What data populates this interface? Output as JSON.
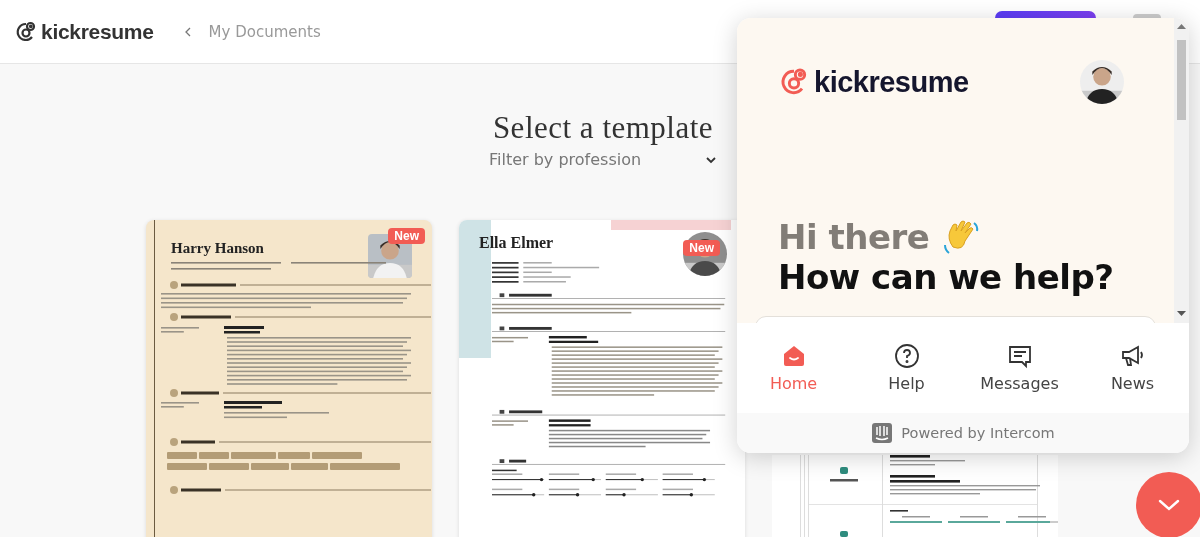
{
  "header": {
    "logo": "kickresume",
    "breadcrumb": "My Documents"
  },
  "page": {
    "title": "Select a template",
    "filter": {
      "placeholder": "Filter by profession"
    }
  },
  "templates": [
    {
      "kind": "classic",
      "badge": "New",
      "name": "Harry Hanson"
    },
    {
      "kind": "modern",
      "badge": "New",
      "name": "Ella Elmer"
    },
    {
      "kind": "table"
    }
  ],
  "widget": {
    "logo": "kickresume",
    "greeting": "Hi there",
    "question": "How can we help?",
    "tabs": [
      {
        "label": "Home",
        "selected": true
      },
      {
        "label": "Help",
        "selected": false
      },
      {
        "label": "Messages",
        "selected": false
      },
      {
        "label": "News",
        "selected": false
      }
    ],
    "footer": "Powered by Intercom"
  }
}
